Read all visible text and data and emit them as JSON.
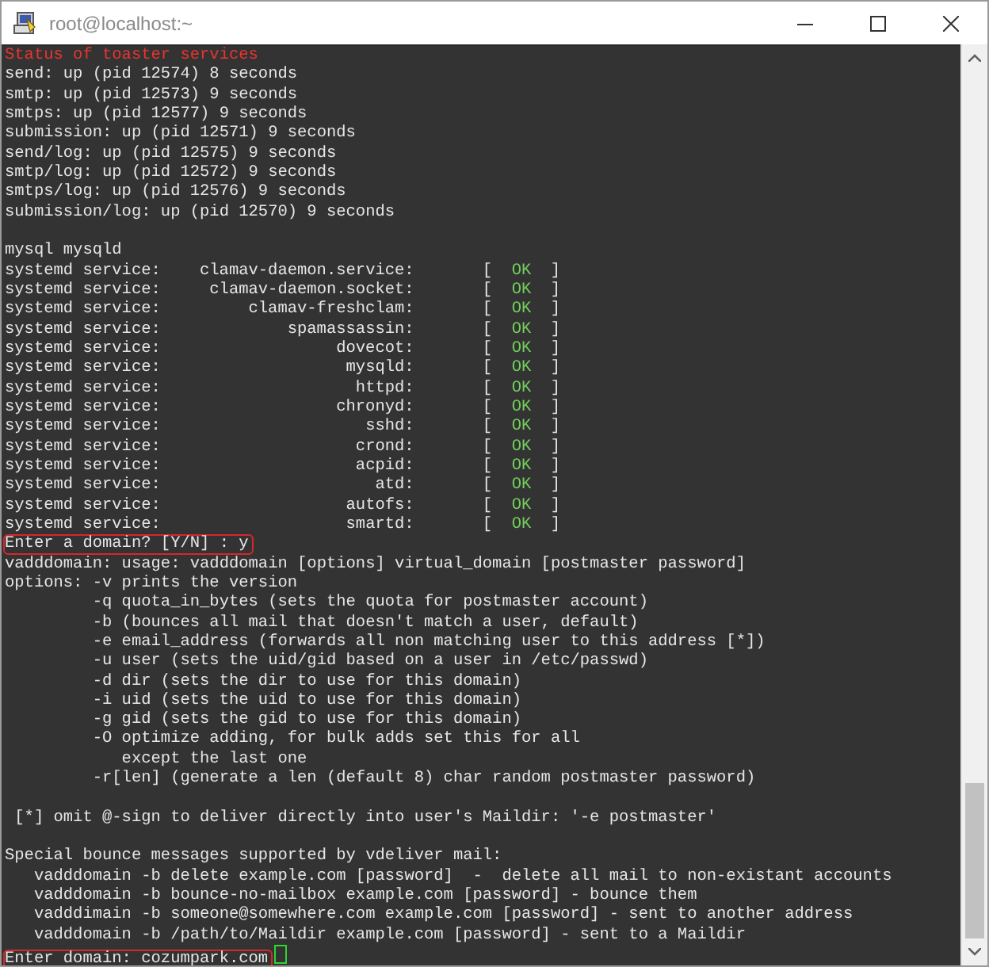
{
  "window": {
    "title": "root@localhost:~"
  },
  "lines": [
    {
      "kind": "heading",
      "text": "Status of toaster services"
    },
    {
      "kind": "plain",
      "text": "send: up (pid 12574) 8 seconds"
    },
    {
      "kind": "plain",
      "text": "smtp: up (pid 12573) 9 seconds"
    },
    {
      "kind": "plain",
      "text": "smtps: up (pid 12577) 9 seconds"
    },
    {
      "kind": "plain",
      "text": "submission: up (pid 12571) 9 seconds"
    },
    {
      "kind": "plain",
      "text": "send/log: up (pid 12575) 9 seconds"
    },
    {
      "kind": "plain",
      "text": "smtp/log: up (pid 12572) 9 seconds"
    },
    {
      "kind": "plain",
      "text": "smtps/log: up (pid 12576) 9 seconds"
    },
    {
      "kind": "plain",
      "text": "submission/log: up (pid 12570) 9 seconds"
    },
    {
      "kind": "blank"
    },
    {
      "kind": "plain",
      "text": "mysql mysqld"
    },
    {
      "kind": "service",
      "label": "systemd service:",
      "name": "clamav-daemon.service:",
      "open": "[",
      "status": "OK",
      "close": "]"
    },
    {
      "kind": "service",
      "label": "systemd service:",
      "name": "clamav-daemon.socket:",
      "open": "[",
      "status": "OK",
      "close": "]"
    },
    {
      "kind": "service",
      "label": "systemd service:",
      "name": "clamav-freshclam:",
      "open": "[",
      "status": "OK",
      "close": "]"
    },
    {
      "kind": "service",
      "label": "systemd service:",
      "name": "spamassassin:",
      "open": "[",
      "status": "OK",
      "close": "]"
    },
    {
      "kind": "service",
      "label": "systemd service:",
      "name": "dovecot:",
      "open": "[",
      "status": "OK",
      "close": "]"
    },
    {
      "kind": "service",
      "label": "systemd service:",
      "name": "mysqld:",
      "open": "[",
      "status": "OK",
      "close": "]"
    },
    {
      "kind": "service",
      "label": "systemd service:",
      "name": "httpd:",
      "open": "[",
      "status": "OK",
      "close": "]"
    },
    {
      "kind": "service",
      "label": "systemd service:",
      "name": "chronyd:",
      "open": "[",
      "status": "OK",
      "close": "]"
    },
    {
      "kind": "service",
      "label": "systemd service:",
      "name": "sshd:",
      "open": "[",
      "status": "OK",
      "close": "]"
    },
    {
      "kind": "service",
      "label": "systemd service:",
      "name": "crond:",
      "open": "[",
      "status": "OK",
      "close": "]"
    },
    {
      "kind": "service",
      "label": "systemd service:",
      "name": "acpid:",
      "open": "[",
      "status": "OK",
      "close": "]"
    },
    {
      "kind": "service",
      "label": "systemd service:",
      "name": "atd:",
      "open": "[",
      "status": "OK",
      "close": "]"
    },
    {
      "kind": "service",
      "label": "systemd service:",
      "name": "autofs:",
      "open": "[",
      "status": "OK",
      "close": "]"
    },
    {
      "kind": "service",
      "label": "systemd service:",
      "name": "smartd:",
      "open": "[",
      "status": "OK",
      "close": "]"
    },
    {
      "kind": "prompt",
      "text": "Enter a domain? [Y/N] : y",
      "highlighted": true,
      "cursor": false
    },
    {
      "kind": "plain",
      "text": "vadddomain: usage: vadddomain [options] virtual_domain [postmaster password]"
    },
    {
      "kind": "plain",
      "text": "options: -v prints the version"
    },
    {
      "kind": "plain",
      "text": "         -q quota_in_bytes (sets the quota for postmaster account)"
    },
    {
      "kind": "plain",
      "text": "         -b (bounces all mail that doesn't match a user, default)"
    },
    {
      "kind": "plain",
      "text": "         -e email_address (forwards all non matching user to this address [*])"
    },
    {
      "kind": "plain",
      "text": "         -u user (sets the uid/gid based on a user in /etc/passwd)"
    },
    {
      "kind": "plain",
      "text": "         -d dir (sets the dir to use for this domain)"
    },
    {
      "kind": "plain",
      "text": "         -i uid (sets the uid to use for this domain)"
    },
    {
      "kind": "plain",
      "text": "         -g gid (sets the gid to use for this domain)"
    },
    {
      "kind": "plain",
      "text": "         -O optimize adding, for bulk adds set this for all"
    },
    {
      "kind": "plain",
      "text": "            except the last one"
    },
    {
      "kind": "plain",
      "text": "         -r[len] (generate a len (default 8) char random postmaster password)"
    },
    {
      "kind": "blank"
    },
    {
      "kind": "plain",
      "text": " [*] omit @-sign to deliver directly into user's Maildir: '-e postmaster'"
    },
    {
      "kind": "blank"
    },
    {
      "kind": "plain",
      "text": "Special bounce messages supported by vdeliver mail:"
    },
    {
      "kind": "plain",
      "text": "   vadddomain -b delete example.com [password]  -  delete all mail to non-existant accounts"
    },
    {
      "kind": "plain",
      "text": "   vadddomain -b bounce-no-mailbox example.com [password] - bounce them"
    },
    {
      "kind": "plain",
      "text": "   vadddimain -b someone@somewhere.com example.com [password] - sent to another address"
    },
    {
      "kind": "plain",
      "text": "   vadddomain -b /path/to/Maildir example.com [password] - sent to a Maildir"
    },
    {
      "kind": "prompt",
      "text": "Enter domain: cozumpark.com",
      "highlighted": true,
      "cursor": true
    }
  ]
}
